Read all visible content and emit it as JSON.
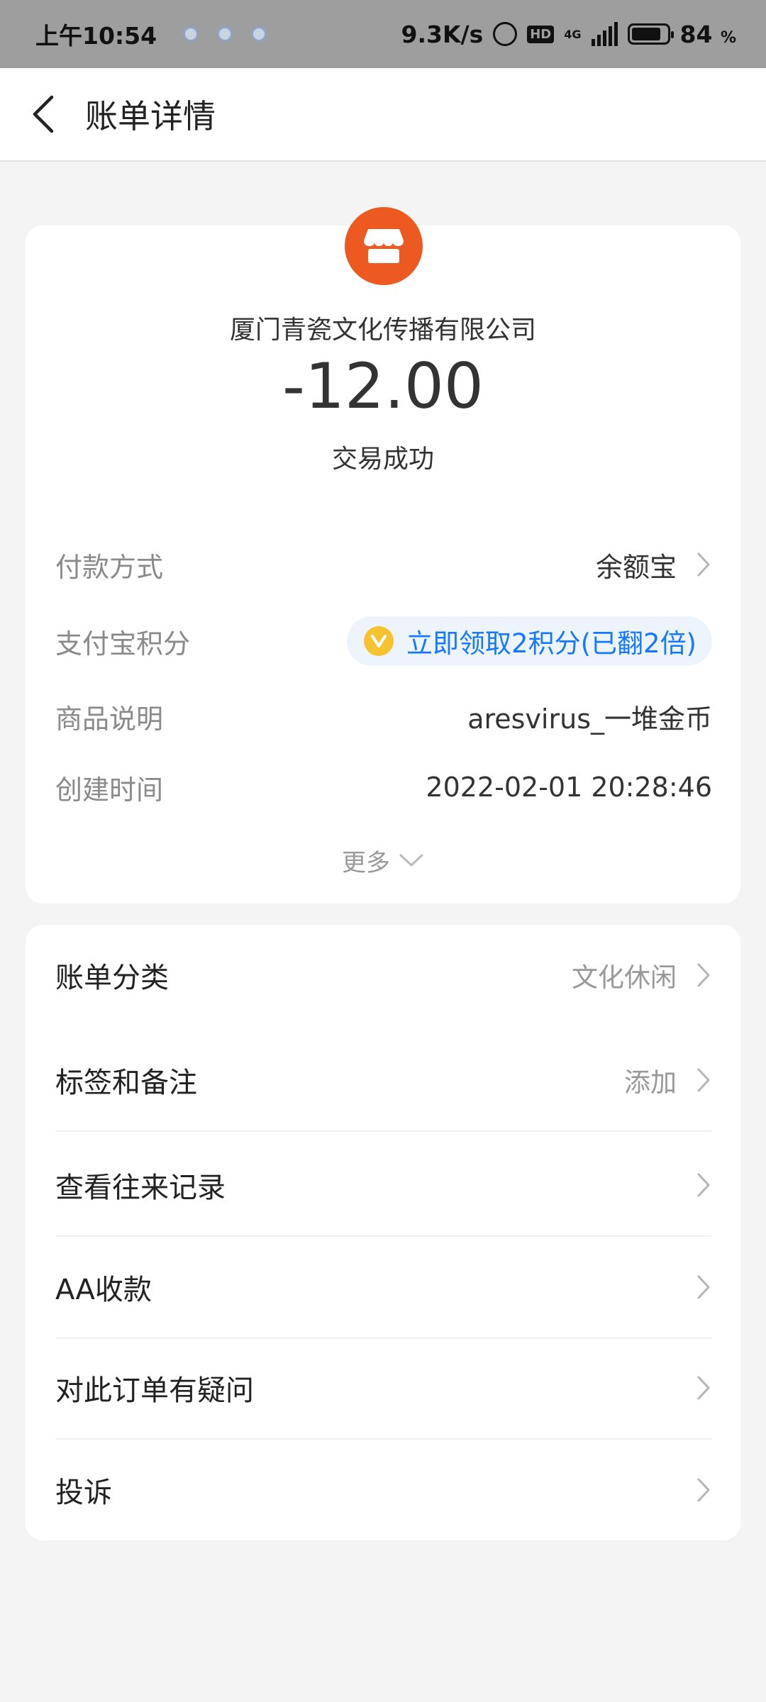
{
  "status_bar": {
    "time": "上午10:54",
    "speed": "9.3K/s",
    "hd": "HD",
    "network": "4G",
    "battery": "84",
    "battery_unit": "%",
    "battery_level": 0.84
  },
  "header": {
    "title": "账单详情",
    "back_icon": "chevron-left-icon"
  },
  "summary": {
    "merchant_icon": "store-icon",
    "merchant_icon_color": "#ec5a22",
    "merchant": "厦门青瓷文化传播有限公司",
    "amount": "-12.00",
    "status": "交易成功"
  },
  "details": {
    "payment_method_label": "付款方式",
    "payment_method_value": "余额宝",
    "points_label": "支付宝积分",
    "points_value": "立即领取2积分(已翻2倍)",
    "points_color": "#1677ff",
    "product_label": "商品说明",
    "product_value": "aresvirus_一堆金币",
    "created_label": "创建时间",
    "created_value": "2022-02-01 20:28:46",
    "more_label": "更多"
  },
  "actions": {
    "category_label": "账单分类",
    "category_value": "文化休闲",
    "tags_label": "标签和备注",
    "tags_value": "添加",
    "history_label": "查看往来记录",
    "aa_label": "AA收款",
    "question_label": "对此订单有疑问",
    "complaint_label": "投诉"
  }
}
